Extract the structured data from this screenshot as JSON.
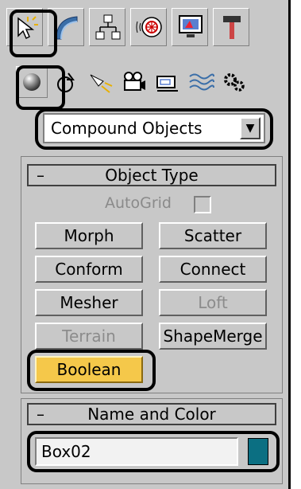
{
  "tabs": [
    {
      "icon": "create-cursor-icon"
    },
    {
      "icon": "modify-icon"
    },
    {
      "icon": "hierarchy-icon"
    },
    {
      "icon": "motion-icon"
    },
    {
      "icon": "display-icon"
    },
    {
      "icon": "utilities-hammer-icon"
    }
  ],
  "subcategories": [
    "geometry-sphere-icon",
    "shapes-icon",
    "lights-icon",
    "cameras-icon",
    "helpers-icon",
    "space-warps-icon",
    "systems-icon"
  ],
  "category_dropdown": {
    "value": "Compound Objects",
    "arrow": "▼"
  },
  "object_type": {
    "collapse": "–",
    "title": "Object Type",
    "autogrid_label": "AutoGrid",
    "buttons": {
      "morph": "Morph",
      "scatter": "Scatter",
      "conform": "Conform",
      "connect": "Connect",
      "mesher": "Mesher",
      "loft": "Loft",
      "terrain": "Terrain",
      "shapemerge": "ShapeMerge",
      "boolean": "Boolean"
    }
  },
  "name_and_color": {
    "collapse": "–",
    "title": "Name and Color",
    "name_value": "Box02",
    "color": "#0b6f82"
  },
  "colors": {
    "selected_button": "#f5c84a",
    "panel_bg": "#c8c8c8"
  }
}
